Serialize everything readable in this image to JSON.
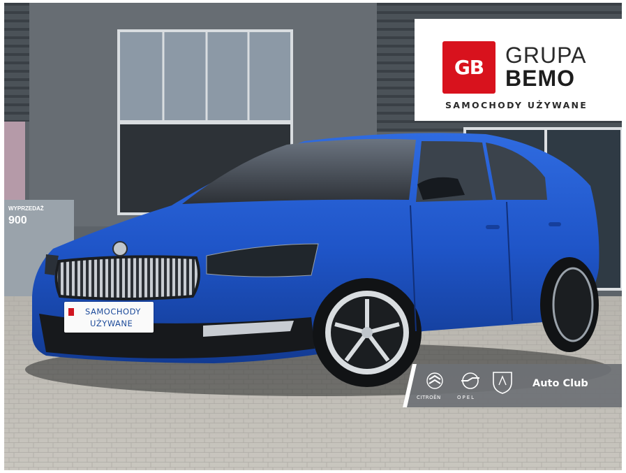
{
  "dealer": {
    "logo_mark": "GB",
    "name_line1": "GRUPA",
    "name_line2": "BEMO",
    "tagline": "SAMOCHODY UŻYWANE"
  },
  "plate": {
    "line1": "SAMOCHODY",
    "line2": "UŻYWANE"
  },
  "club_banner": {
    "label": "Auto Club",
    "brand1": "CITROËN",
    "brand2": "OPEL",
    "brand_icons": [
      "citroen-logo-icon",
      "opel-logo-icon",
      "peugeot-logo-icon"
    ]
  },
  "background_sign": {
    "text": "WYPRZEDAŻ",
    "number": "900"
  },
  "colors": {
    "car_body": "#1f55c8",
    "brand_red": "#d8121d",
    "banner_gray": "#6e7175"
  }
}
